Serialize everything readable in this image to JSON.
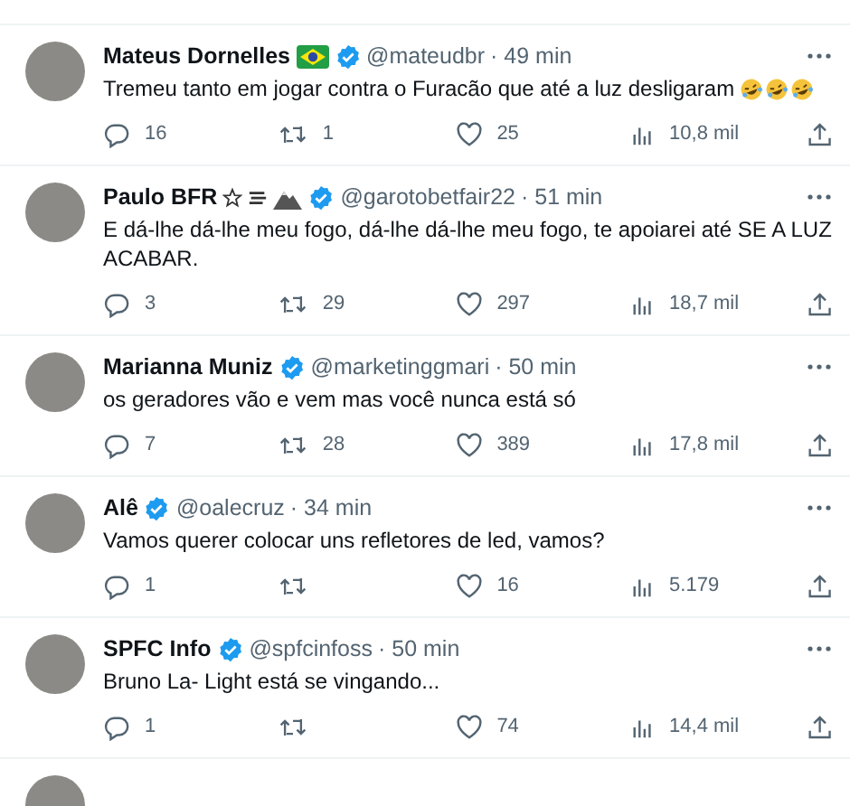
{
  "tweets": [
    {
      "name": "Mateus Dornelles",
      "badges": [
        {
          "kind": "flag"
        }
      ],
      "verified": true,
      "handle": "@mateudbr",
      "time": "· 49 min",
      "text": "Tremeu tanto em jogar contra o Furacão que até a luz desligaram",
      "emojis": [
        {
          "kind": "laughing"
        },
        {
          "kind": "laughing"
        },
        {
          "kind": "laughing"
        }
      ],
      "replies": "16",
      "reposts": "1",
      "likes": "25",
      "views": "10,8 mil"
    },
    {
      "name": "Paulo BFR",
      "badges": [
        {
          "kind": "star"
        },
        {
          "kind": "wind"
        },
        {
          "kind": "mountain"
        }
      ],
      "verified": true,
      "handle": "@garotobetfair22",
      "time": "· 51 min",
      "text": "E dá-lhe dá-lhe meu fogo, dá-lhe dá-lhe meu fogo, te apoiarei até SE A LUZ ACABAR.",
      "replies": "3",
      "reposts": "29",
      "likes": "297",
      "views": "18,7 mil"
    },
    {
      "name": "Marianna Muniz",
      "verified": true,
      "handle": "@marketinggmari",
      "time": "· 50 min",
      "text": "os geradores vão e vem mas você nunca está só",
      "replies": "7",
      "reposts": "28",
      "likes": "389",
      "views": "17,8 mil"
    },
    {
      "name": "Alê",
      "verified": true,
      "handle": "@oalecruz",
      "time": "· 34 min",
      "text": "Vamos querer colocar uns refletores de led, vamos?",
      "replies": "1",
      "likes": "16",
      "views": "5.179"
    },
    {
      "name": "SPFC Info",
      "verified": true,
      "handle": "@spfcinfoss",
      "time": "· 50 min",
      "text": "Bruno La- Light está se vingando...",
      "replies": "1",
      "likes": "74",
      "views": "14,4 mil"
    }
  ]
}
